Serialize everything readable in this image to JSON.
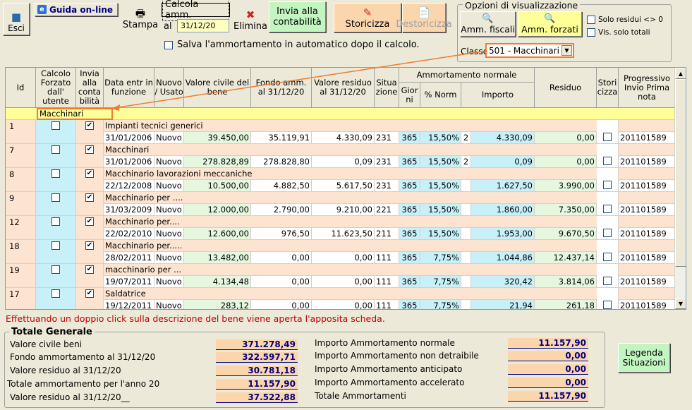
{
  "toolbar": {
    "exit": "Esci",
    "guide": "Guida on-line",
    "print": "Stampa",
    "calc": "Calcola amm.",
    "al": "al",
    "date": "31/12/20",
    "delete": "Elimina",
    "send": "Invia alla contabilità",
    "historicize": "Storicizza",
    "unhistoricize": "Destoricizza",
    "autosave": "Salva l'ammortamento in automatico dopo il calcolo."
  },
  "options": {
    "title": "Opzioni di visualizzazione",
    "fiscal": "Amm. fiscali",
    "forced": "Amm. forzati",
    "only_residual": "Solo residui <> 0",
    "only_totals": "Vis. solo totali",
    "class_label": "Classe",
    "class_value": "501 - Macchinari"
  },
  "columns": {
    "id": "Id",
    "forced": "Calcolo Forzato dall' utente",
    "send": "Invia alla conta bilità",
    "date": "Data entr in funzione",
    "new": "Nuovo / Usato",
    "civil": "Valore civile del bene",
    "fund": "Fondo amm. al 31/12/20",
    "residual": "Valore residuo al 31/12/20",
    "situation": "Situa zione",
    "normal": "Ammortamento normale",
    "days": "Gior ni",
    "pct": "% Norm",
    "amount": "Importo",
    "residuo": "Residuo",
    "stori": "Stori cizza",
    "prog": "Progressivo Invio Prima nota"
  },
  "group_label": "Macchinari",
  "rows": [
    {
      "id": "1",
      "desc": "Impianti tecnici generici",
      "send": true,
      "date": "31/01/2006",
      "new": "Nuovo",
      "civil": "39.450,00",
      "fund": "35.119,91",
      "residual": "4.330,09",
      "sit": "231",
      "days": "365",
      "pct": "15,50%",
      "n": "2",
      "amount": "4.330,09",
      "residuo": "0,00",
      "prog": "201101589"
    },
    {
      "id": "7",
      "desc": "Macchinari",
      "send": true,
      "date": "31/01/2006",
      "new": "Nuovo",
      "civil": "278.828,89",
      "fund": "278.828,80",
      "residual": "0,09",
      "sit": "231",
      "days": "365",
      "pct": "15,50%",
      "n": "2",
      "amount": "0,09",
      "residuo": "0,00",
      "prog": "201101589"
    },
    {
      "id": "8",
      "desc": "Macchinario lavorazioni meccaniche",
      "send": true,
      "date": "22/12/2008",
      "new": "Nuovo",
      "civil": "10.500,00",
      "fund": "4.882,50",
      "residual": "5.617,50",
      "sit": "231",
      "days": "365",
      "pct": "15,50%",
      "n": "",
      "amount": "1.627,50",
      "residuo": "3.990,00",
      "prog": "201101589"
    },
    {
      "id": "9",
      "desc": "Macchinario per ....",
      "send": true,
      "date": "31/03/2009",
      "new": "Nuovo",
      "civil": "12.000,00",
      "fund": "2.790,00",
      "residual": "9.210,00",
      "sit": "221",
      "days": "365",
      "pct": "15,50%",
      "n": "",
      "amount": "1.860,00",
      "residuo": "7.350,00",
      "prog": "201101589"
    },
    {
      "id": "12",
      "desc": "Macchinario per....",
      "send": true,
      "date": "22/02/2010",
      "new": "Nuovo",
      "civil": "12.600,00",
      "fund": "976,50",
      "residual": "11.623,50",
      "sit": "211",
      "days": "365",
      "pct": "15,50%",
      "n": "",
      "amount": "1.953,00",
      "residuo": "9.670,50",
      "prog": "201101589"
    },
    {
      "id": "18",
      "desc": "Macchinario per.....",
      "send": true,
      "date": "28/02/2011",
      "new": "Nuovo",
      "civil": "13.482,00",
      "fund": "0,00",
      "residual": "0,00",
      "sit": "111",
      "days": "365",
      "pct": "7,75%",
      "n": "",
      "amount": "1.044,86",
      "residuo": "12.437,14",
      "prog": "201101589"
    },
    {
      "id": "19",
      "desc": "macchinario per ...",
      "send": true,
      "date": "19/07/2011",
      "new": "Nuovo",
      "civil": "4.134,48",
      "fund": "0,00",
      "residual": "0,00",
      "sit": "111",
      "days": "365",
      "pct": "7,75%",
      "n": "",
      "amount": "320,42",
      "residuo": "3.814,06",
      "prog": "201101589"
    },
    {
      "id": "17",
      "desc": "Saldatrice",
      "send": true,
      "date": "19/12/2011",
      "new": "Nuovo",
      "civil": "283,12",
      "fund": "0,00",
      "residual": "0,00",
      "sit": "111",
      "days": "365",
      "pct": "7,75%",
      "n": "",
      "amount": "21,94",
      "residuo": "261,18",
      "prog": "201101589"
    }
  ],
  "hint": "Effettuando un doppio click sulla descrizione del bene viene aperta l'apposita scheda.",
  "totals": {
    "title": "Totale Generale",
    "left": [
      {
        "label": "Valore civile beni",
        "value": "371.278,49"
      },
      {
        "label": "Fondo ammortamento al 31/12/20",
        "value": "322.597,71"
      },
      {
        "label": "Valore residuo al 31/12/20",
        "value": "30.781,18"
      },
      {
        "label": "Totale ammortamento per l'anno 20",
        "value": "11.157,90"
      },
      {
        "label": "Valore residuo al 31/12/20__",
        "value": "37.522,88"
      }
    ],
    "right": [
      {
        "label": "Importo Ammortamento normale",
        "value": "11.157,90"
      },
      {
        "label": "Importo Ammortamento non detraibile",
        "value": "0,00"
      },
      {
        "label": "Importo Ammortamento anticipato",
        "value": "0,00"
      },
      {
        "label": "Importo Ammortamento accelerato",
        "value": "0,00"
      },
      {
        "label": "Totale Ammortamenti",
        "value": "11.157,90"
      }
    ]
  },
  "legend": "Legenda Situazioni"
}
